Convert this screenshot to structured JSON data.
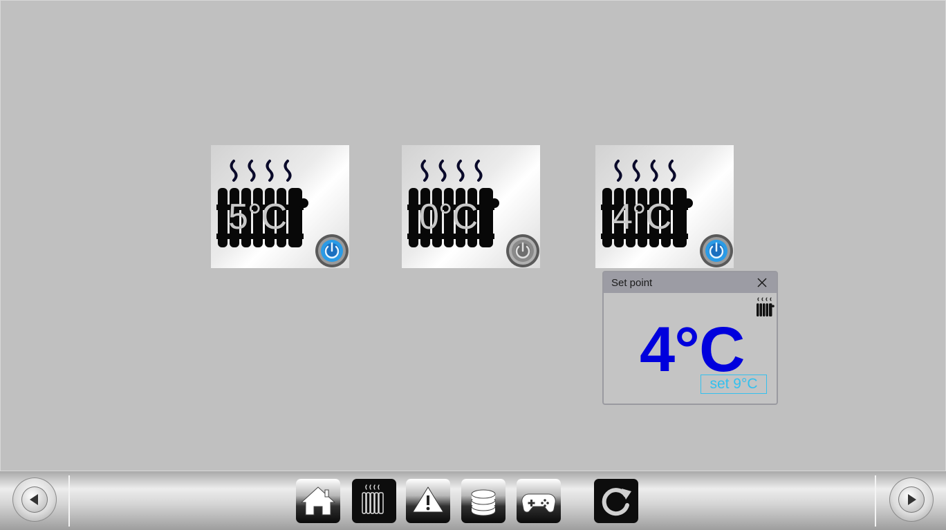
{
  "tiles": [
    {
      "temp": "5°C",
      "power_state": "on"
    },
    {
      "temp": "0°C",
      "power_state": "off"
    },
    {
      "temp": "4°C",
      "power_state": "on"
    }
  ],
  "popup": {
    "title": "Set point",
    "current_temp": "4°C",
    "set_label": "set 9°C"
  },
  "toolbar": {
    "buttons": [
      {
        "icon": "home-icon"
      },
      {
        "icon": "radiator-icon"
      },
      {
        "icon": "warning-icon"
      },
      {
        "icon": "database-icon"
      },
      {
        "icon": "gamepad-icon"
      },
      {
        "icon": "refresh-icon"
      }
    ],
    "left_nav_icon": "back-arrow-icon",
    "right_nav_icon": "forward-arrow-icon"
  },
  "colors": {
    "background": "#c0c0c0",
    "popup_temp": "#0000dd",
    "setpoint_accent": "#33c0ee",
    "power_on": "#1e90e0",
    "power_off": "#8a8a8a"
  }
}
